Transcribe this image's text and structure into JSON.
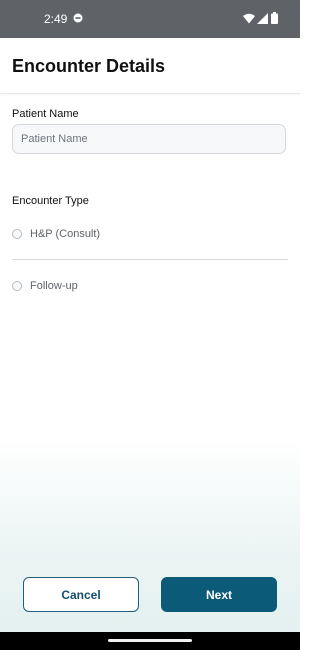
{
  "status_bar": {
    "time": "2:49",
    "icons": [
      "app-notification-icon",
      "wifi-icon",
      "signal-icon",
      "battery-icon"
    ]
  },
  "header": {
    "title": "Encounter Details"
  },
  "form": {
    "patient_name": {
      "label": "Patient Name",
      "value": "",
      "placeholder": "Patient Name"
    },
    "encounter_type": {
      "label": "Encounter Type",
      "options": [
        {
          "label": "H&P (Consult)",
          "selected": false
        },
        {
          "label": "Follow-up",
          "selected": false
        }
      ]
    }
  },
  "actions": {
    "cancel_label": "Cancel",
    "next_label": "Next"
  },
  "colors": {
    "status_bar": "#5f6368",
    "primary": "#0b5a78",
    "outline": "#1f5f7e",
    "input_background": "#f7f8fa",
    "gradient_bottom": "#e4f1f0"
  }
}
